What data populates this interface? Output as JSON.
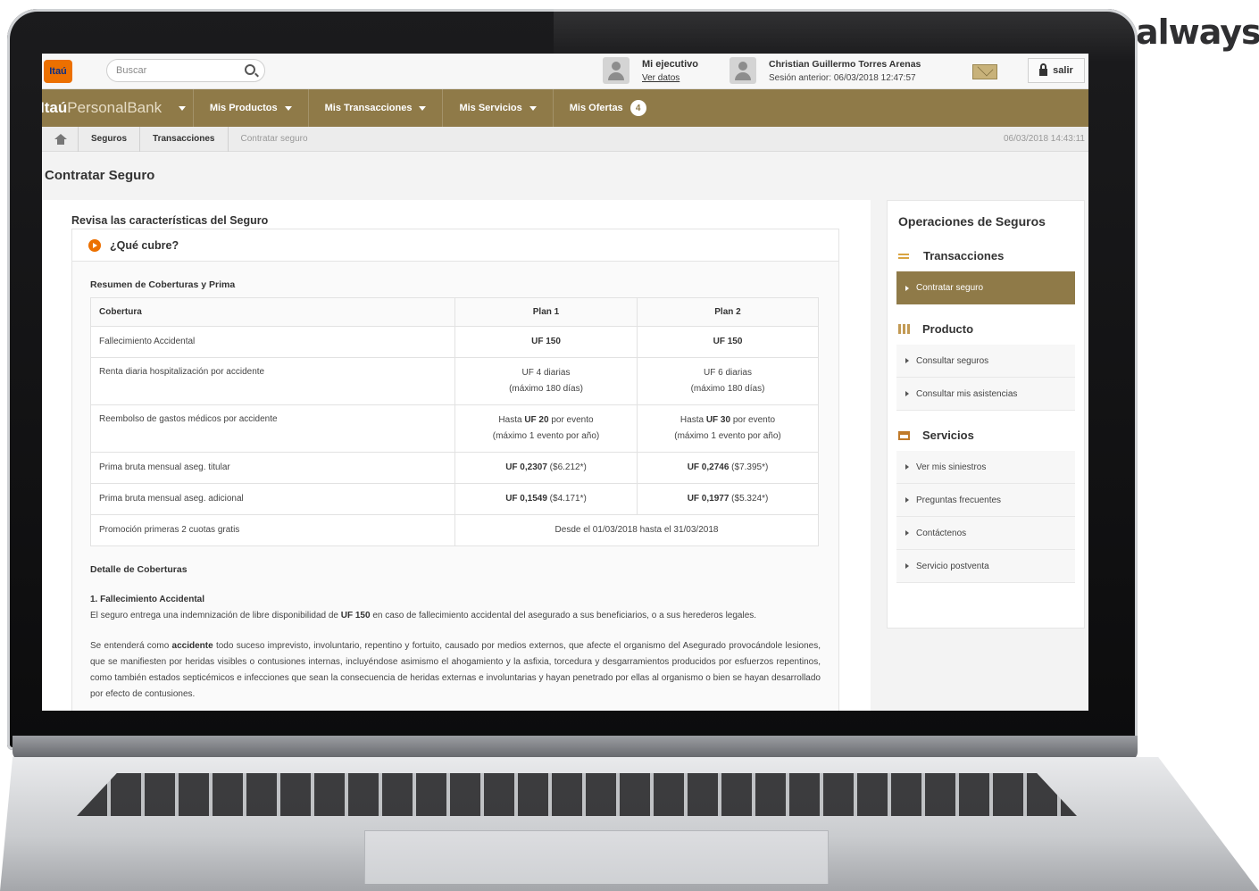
{
  "brand_overlay": "always",
  "topbar": {
    "logo": "Itaú",
    "search_placeholder": "Buscar",
    "executive_title": "Mi ejecutivo",
    "executive_link": "Ver datos",
    "user_name": "Christian Guillermo Torres Arenas",
    "last_session": "Sesión anterior: 06/03/2018 12:47:57",
    "logout": "salir"
  },
  "nav": {
    "brand_bold": "Itaú",
    "brand_light": "PersonalBank",
    "items": [
      {
        "label": "Mis Productos"
      },
      {
        "label": "Mis Transacciones"
      },
      {
        "label": "Mis Servicios"
      },
      {
        "label": "Mis Ofertas"
      }
    ],
    "offers_count": "4"
  },
  "breadcrumb": {
    "items": [
      "Seguros",
      "Transacciones",
      "Contratar seguro"
    ],
    "datetime": "06/03/2018 14:43:11"
  },
  "page_title": "Contratar Seguro",
  "main": {
    "section_title": "Revisa las características del Seguro",
    "coverage_header": "¿Qué cubre?",
    "summary_title": "Resumen de Coberturas y Prima",
    "table": {
      "headers": [
        "Cobertura",
        "Plan 1",
        "Plan 2"
      ],
      "rows": [
        {
          "label": "Fallecimiento Accidental",
          "p1": "UF 150",
          "p2": "UF 150"
        },
        {
          "label": "Renta diaria hospitalización por accidente",
          "p1a": "UF 4 diarias",
          "p1b": "(máximo 180 días)",
          "p2a": "UF 6 diarias",
          "p2b": "(máximo 180 días)"
        },
        {
          "label": "Reembolso de gastos médicos por accidente",
          "p1pre": "Hasta",
          "p1bold": "UF 20",
          "p1post": "por evento",
          "p1b": "(máximo 1 evento por año)",
          "p2pre": "Hasta",
          "p2bold": "UF 30",
          "p2post": "por evento",
          "p2b": "(máximo 1 evento por año)"
        },
        {
          "label": "Prima bruta mensual aseg. titular",
          "p1bold": "UF 0,2307",
          "p1rest": "($6.212*)",
          "p2bold": "UF 0,2746",
          "p2rest": "($7.395*)"
        },
        {
          "label": "Prima bruta mensual aseg. adicional",
          "p1bold": "UF 0,1549",
          "p1rest": "($4.171*)",
          "p2bold": "UF 0,1977",
          "p2rest": "($5.324*)"
        },
        {
          "label": "Promoción primeras 2 cuotas gratis",
          "span": "Desde el 01/03/2018 hasta el 31/03/2018"
        }
      ]
    },
    "detail_title": "Detalle de Coberturas",
    "item1_title": "1. Fallecimiento Accidental",
    "item1_p1_a": "El seguro entrega una indemnización de libre disponibilidad de",
    "item1_p1_bold": "UF 150",
    "item1_p1_b": "en caso de fallecimiento accidental del asegurado a sus beneficiarios, o a sus herederos legales.",
    "item1_p2_a": "Se entenderá como",
    "item1_p2_bold": "accidente",
    "item1_p2_b": "todo suceso imprevisto, involuntario, repentino y fortuito, causado por medios externos, que afecte el organismo del Asegurado provocándole lesiones, que se manifiesten por heridas visibles o contusiones internas, incluyéndose asimismo el ahogamiento y la asfixia, torcedura y desgarramientos producidos por esfuerzos repentinos, como también estados septicémicos e infecciones que sean la consecuencia de heridas externas e involuntarias y hayan penetrado por ellas al organismo o bien se hayan desarrollado por efecto de contusiones."
  },
  "sidebar": {
    "title": "Operaciones de Seguros",
    "groups": [
      {
        "label": "Transacciones",
        "links": [
          "Contratar seguro"
        ]
      },
      {
        "label": "Producto",
        "links": [
          "Consultar seguros",
          "Consultar mis asistencias"
        ]
      },
      {
        "label": "Servicios",
        "links": [
          "Ver mis siniestros",
          "Preguntas frecuentes",
          "Contáctenos",
          "Servicio postventa"
        ]
      }
    ]
  },
  "colors": {
    "brand_gold": "#8f7a48",
    "itau_orange": "#ec7000",
    "itau_blue": "#0b2f85"
  }
}
